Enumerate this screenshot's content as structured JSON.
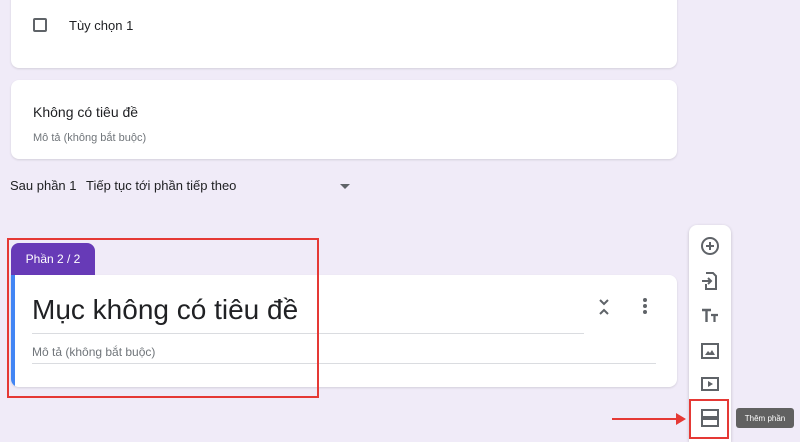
{
  "option_card": {
    "option_label": "Tùy chọn 1"
  },
  "section1": {
    "title": "Không có tiêu đề",
    "description_placeholder": "Mô tả (không bắt buộc)"
  },
  "after_section": {
    "label": "Sau phần 1",
    "selected": "Tiếp tục tới phần tiếp theo"
  },
  "section2": {
    "tab_label": "Phần 2 / 2",
    "title": "Mục không có tiêu đề",
    "description_placeholder": "Mô tả (không bắt buộc)",
    "accent_color": "#673ab7",
    "left_bar_color": "#4285f4"
  },
  "toolbar": {
    "buttons": [
      {
        "icon": "add-question-icon"
      },
      {
        "icon": "import-questions-icon"
      },
      {
        "icon": "add-title-icon"
      },
      {
        "icon": "add-image-icon"
      },
      {
        "icon": "add-video-icon"
      },
      {
        "icon": "add-section-icon"
      }
    ],
    "tooltip": "Thêm phần"
  },
  "highlight_color": "#e53935"
}
